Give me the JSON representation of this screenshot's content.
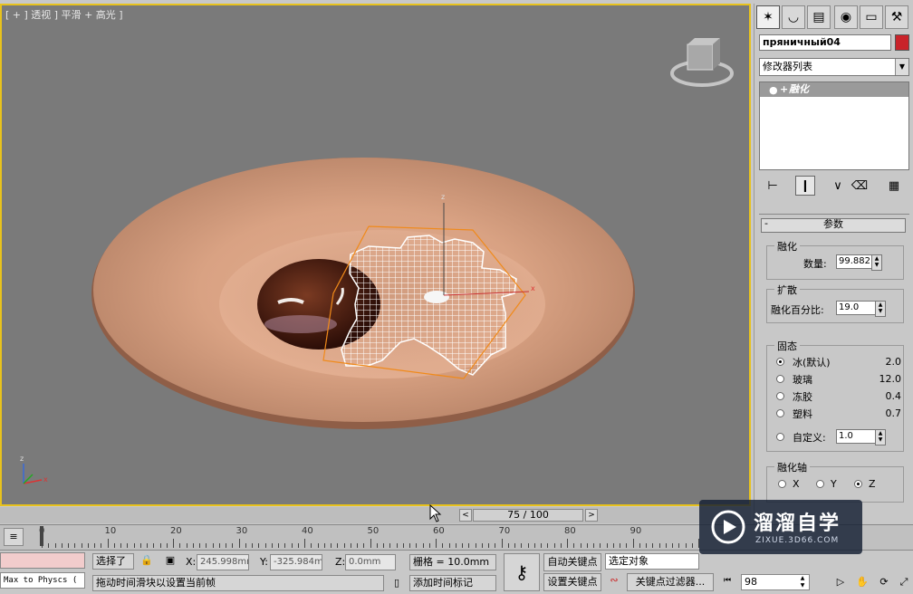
{
  "viewport": {
    "label": "[ + ] 透视 ] 平滑 + 高光 ]",
    "gizmo_z": "z",
    "gizmo_x": "x",
    "axis_z": "z",
    "axis_x": "x"
  },
  "command_panel": {
    "tabs": [
      "create-icon",
      "modify-icon",
      "hierarchy-icon",
      "motion-icon",
      "display-icon",
      "utilities-icon"
    ],
    "object_name": "пряничный04",
    "object_color": "#c9232a",
    "modifier_list": "修改器列表",
    "stack_item": "融化",
    "rollout_title": "参数",
    "melt_group": "融化",
    "amount_label": "数量:",
    "amount_value": "99.882",
    "spread_group": "扩散",
    "spread_label": "融化百分比:",
    "spread_value": "19.0",
    "solidity_group": "固态",
    "solidity_options": [
      {
        "label": "冰(默认)",
        "value": "2.0",
        "selected": true
      },
      {
        "label": "玻璃",
        "value": "12.0",
        "selected": false
      },
      {
        "label": "冻胶",
        "value": "0.4",
        "selected": false
      },
      {
        "label": "塑料",
        "value": "0.7",
        "selected": false
      }
    ],
    "custom_label": "自定义:",
    "custom_value": "1.0",
    "axis_group": "融化轴",
    "axis_options": [
      {
        "label": "X",
        "selected": false
      },
      {
        "label": "Y",
        "selected": false
      },
      {
        "label": "Z",
        "selected": true
      }
    ]
  },
  "timeline": {
    "slider_text": "75 / 100",
    "prev": "<",
    "next": ">",
    "ruler_labels": [
      "0",
      "10",
      "20",
      "30",
      "40",
      "50",
      "60",
      "70",
      "80",
      "90"
    ]
  },
  "status": {
    "script_listener": "Max to Physcs (",
    "selected": "选择了",
    "x_label": "X:",
    "x_value": "245.998mm",
    "y_label": "Y:",
    "y_value": "-325.984m",
    "z_label": "Z:",
    "z_value": "0.0mm",
    "grid": "栅格 = 10.0mm",
    "auto_key": "自动关键点",
    "selected_object": "选定对象",
    "set_key": "设置关键点",
    "key_filters": "关键点过滤器...",
    "frame": "98",
    "prompt": "拖动时间滑块以设置当前帧",
    "add_time_tag": "添加时间标记"
  },
  "watermark": {
    "name": "溜溜自学",
    "url": "ZIXUE.3D66.COM"
  }
}
